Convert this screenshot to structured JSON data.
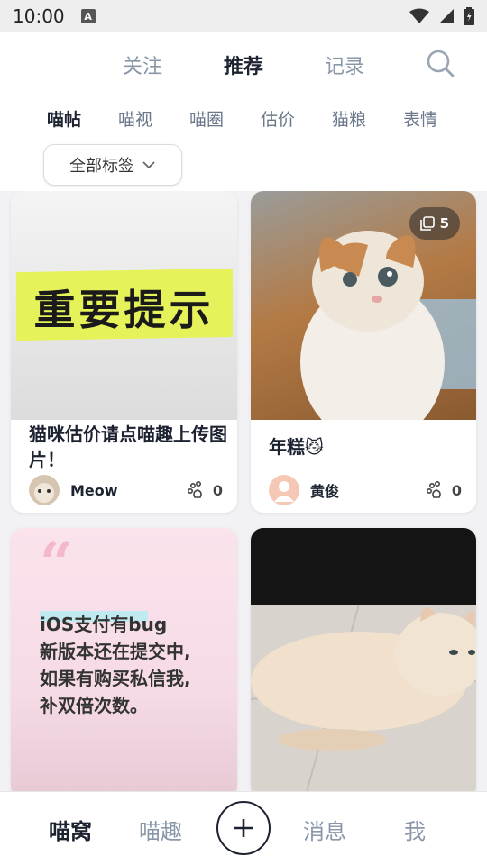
{
  "status_bar": {
    "time": "10:00",
    "badge": "A"
  },
  "top_tabs": [
    {
      "label": "关注"
    },
    {
      "label": "推荐"
    },
    {
      "label": "记录"
    }
  ],
  "category_tabs": [
    {
      "label": "喵帖"
    },
    {
      "label": "喵视"
    },
    {
      "label": "喵圈"
    },
    {
      "label": "估价"
    },
    {
      "label": "猫粮"
    },
    {
      "label": "表情"
    }
  ],
  "tag_filter": {
    "label": "全部标签"
  },
  "posts": [
    {
      "title": "猫咪估价请点喵趣上传图片！",
      "author": "Meow",
      "likes": "0",
      "image_text": "重要提示"
    },
    {
      "title": "年糕😼",
      "author": "黄俊",
      "likes": "0",
      "photo_count": "5"
    },
    {
      "quote_lines": [
        "iOS支付有bug",
        "新版本还在提交中,",
        "如果有购买私信我,",
        "补双倍次数。"
      ]
    },
    {}
  ],
  "bottom_nav": [
    {
      "label": "喵窝"
    },
    {
      "label": "喵趣"
    },
    {
      "label": "消息"
    },
    {
      "label": "我"
    }
  ],
  "colors": {
    "accent": "#1c2230",
    "inactive": "#8a97a8",
    "highlight": "#e6f25a",
    "quote_bg": "#fbe3ec"
  },
  "icons": [
    "search-icon",
    "chevron-down-icon",
    "paw-icon",
    "gallery-icon",
    "plus-icon",
    "wifi-icon",
    "signal-icon",
    "battery-icon"
  ]
}
